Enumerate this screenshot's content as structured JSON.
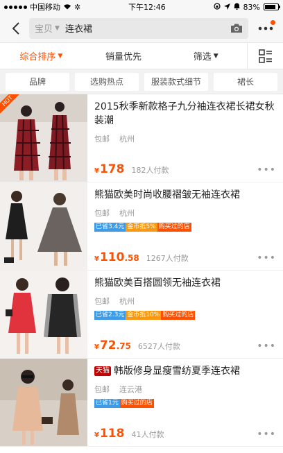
{
  "status": {
    "carrier": "中国移动",
    "time": "下午12:46",
    "battery": "83%",
    "battery_level": 0.83
  },
  "search": {
    "scope": "宝贝",
    "query": "连衣裙"
  },
  "sort": {
    "items": [
      "综合排序",
      "销量优先",
      "筛选"
    ]
  },
  "filters": [
    "品牌",
    "选购热点",
    "服装款式细节",
    "裙长"
  ],
  "products": [
    {
      "hot": "HOT",
      "title": "2015秋季新款格子九分袖连衣裙长裙女秋装潮",
      "shipping": "包邮",
      "location": "杭州",
      "currency": "¥",
      "price_int": "178",
      "price_dec": "",
      "sold": "182人付款",
      "badges": []
    },
    {
      "title": "熊猫欧美时尚收腰褶皱无袖连衣裙",
      "shipping": "包邮",
      "location": "杭州",
      "currency": "¥",
      "price_int": "110",
      "price_dec": ".58",
      "sold": "1267人付款",
      "badges": [
        {
          "text": "已省3.4元",
          "color": "blue"
        },
        {
          "text": "金币抵5%",
          "color": "orange"
        },
        {
          "text": "购买过的店",
          "color": "red"
        }
      ]
    },
    {
      "title": "熊猫欧美百搭圆领无袖连衣裙",
      "shipping": "包邮",
      "location": "杭州",
      "currency": "¥",
      "price_int": "72",
      "price_dec": ".75",
      "sold": "6527人付款",
      "badges": [
        {
          "text": "已省2.3元",
          "color": "blue"
        },
        {
          "text": "金币抵10%",
          "color": "orange"
        },
        {
          "text": "购买过的店",
          "color": "red"
        }
      ]
    },
    {
      "tmall": "天猫",
      "title": "韩版修身显瘦雪纺夏季连衣裙",
      "shipping": "包邮",
      "location": "连云港",
      "currency": "¥",
      "price_int": "118",
      "price_dec": "",
      "sold": "41人付款",
      "badges": [
        {
          "text": "已省1元",
          "color": "blue"
        },
        {
          "text": "购买过的店",
          "color": "red"
        }
      ]
    }
  ],
  "colors": {
    "accent": "#ff5000",
    "tmall": "#c40000",
    "badge_blue": "#3d9be8",
    "badge_orange": "#f79a12"
  }
}
